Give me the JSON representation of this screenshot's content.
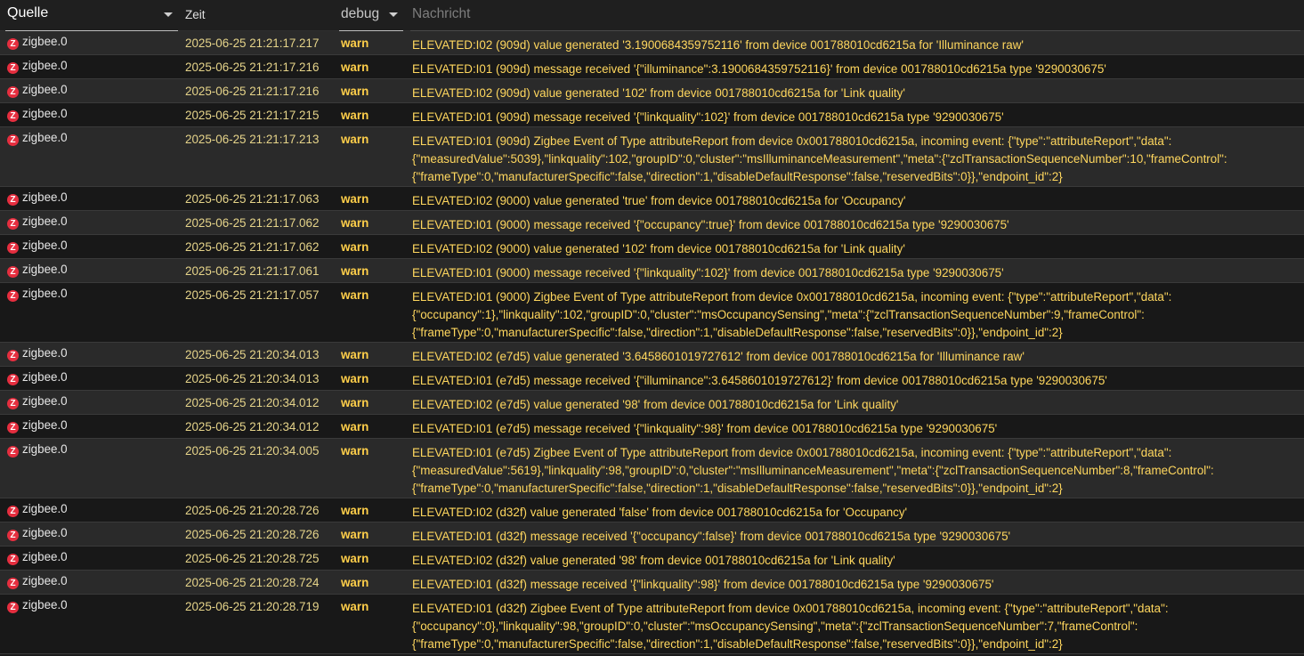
{
  "header": {
    "source_label": "Quelle",
    "time_label": "Zeit",
    "level_label": "debug",
    "message_placeholder": "Nachricht"
  },
  "rows": [
    {
      "source": "zigbee.0",
      "time": "2025-06-25 21:21:17.217",
      "level": "warn",
      "message": "ELEVATED:I02 (909d) value generated '3.1900684359752116' from device 001788010cd6215a for 'Illuminance raw'"
    },
    {
      "source": "zigbee.0",
      "time": "2025-06-25 21:21:17.216",
      "level": "warn",
      "message": "ELEVATED:I01 (909d) message received '{\"illuminance\":3.1900684359752116}' from device 001788010cd6215a type '9290030675'"
    },
    {
      "source": "zigbee.0",
      "time": "2025-06-25 21:21:17.216",
      "level": "warn",
      "message": "ELEVATED:I02 (909d) value generated '102' from device 001788010cd6215a for 'Link quality'"
    },
    {
      "source": "zigbee.0",
      "time": "2025-06-25 21:21:17.215",
      "level": "warn",
      "message": "ELEVATED:I01 (909d) message received '{\"linkquality\":102}' from device 001788010cd6215a type '9290030675'"
    },
    {
      "source": "zigbee.0",
      "time": "2025-06-25 21:21:17.213",
      "level": "warn",
      "message": "ELEVATED:I01 (909d) Zigbee Event of Type attributeReport from device 0x001788010cd6215a, incoming event: {\"type\":\"attributeReport\",\"data\": {\"measuredValue\":5039},\"linkquality\":102,\"groupID\":0,\"cluster\":\"msIlluminanceMeasurement\",\"meta\":{\"zclTransactionSequenceNumber\":10,\"frameControl\": {\"frameType\":0,\"manufacturerSpecific\":false,\"direction\":1,\"disableDefaultResponse\":false,\"reservedBits\":0}},\"endpoint_id\":2}"
    },
    {
      "source": "zigbee.0",
      "time": "2025-06-25 21:21:17.063",
      "level": "warn",
      "message": "ELEVATED:I02 (9000) value generated 'true' from device 001788010cd6215a for 'Occupancy'"
    },
    {
      "source": "zigbee.0",
      "time": "2025-06-25 21:21:17.062",
      "level": "warn",
      "message": "ELEVATED:I01 (9000) message received '{\"occupancy\":true}' from device 001788010cd6215a type '9290030675'"
    },
    {
      "source": "zigbee.0",
      "time": "2025-06-25 21:21:17.062",
      "level": "warn",
      "message": "ELEVATED:I02 (9000) value generated '102' from device 001788010cd6215a for 'Link quality'"
    },
    {
      "source": "zigbee.0",
      "time": "2025-06-25 21:21:17.061",
      "level": "warn",
      "message": "ELEVATED:I01 (9000) message received '{\"linkquality\":102}' from device 001788010cd6215a type '9290030675'"
    },
    {
      "source": "zigbee.0",
      "time": "2025-06-25 21:21:17.057",
      "level": "warn",
      "message": "ELEVATED:I01 (9000) Zigbee Event of Type attributeReport from device 0x001788010cd6215a, incoming event: {\"type\":\"attributeReport\",\"data\": {\"occupancy\":1},\"linkquality\":102,\"groupID\":0,\"cluster\":\"msOccupancySensing\",\"meta\":{\"zclTransactionSequenceNumber\":9,\"frameControl\": {\"frameType\":0,\"manufacturerSpecific\":false,\"direction\":1,\"disableDefaultResponse\":false,\"reservedBits\":0}},\"endpoint_id\":2}"
    },
    {
      "source": "zigbee.0",
      "time": "2025-06-25 21:20:34.013",
      "level": "warn",
      "message": "ELEVATED:I02 (e7d5) value generated '3.6458601019727612' from device 001788010cd6215a for 'Illuminance raw'"
    },
    {
      "source": "zigbee.0",
      "time": "2025-06-25 21:20:34.013",
      "level": "warn",
      "message": "ELEVATED:I01 (e7d5) message received '{\"illuminance\":3.6458601019727612}' from device 001788010cd6215a type '9290030675'"
    },
    {
      "source": "zigbee.0",
      "time": "2025-06-25 21:20:34.012",
      "level": "warn",
      "message": "ELEVATED:I02 (e7d5) value generated '98' from device 001788010cd6215a for 'Link quality'"
    },
    {
      "source": "zigbee.0",
      "time": "2025-06-25 21:20:34.012",
      "level": "warn",
      "message": "ELEVATED:I01 (e7d5) message received '{\"linkquality\":98}' from device 001788010cd6215a type '9290030675'"
    },
    {
      "source": "zigbee.0",
      "time": "2025-06-25 21:20:34.005",
      "level": "warn",
      "message": "ELEVATED:I01 (e7d5) Zigbee Event of Type attributeReport from device 0x001788010cd6215a, incoming event: {\"type\":\"attributeReport\",\"data\": {\"measuredValue\":5619},\"linkquality\":98,\"groupID\":0,\"cluster\":\"msIlluminanceMeasurement\",\"meta\":{\"zclTransactionSequenceNumber\":8,\"frameControl\": {\"frameType\":0,\"manufacturerSpecific\":false,\"direction\":1,\"disableDefaultResponse\":false,\"reservedBits\":0}},\"endpoint_id\":2}"
    },
    {
      "source": "zigbee.0",
      "time": "2025-06-25 21:20:28.726",
      "level": "warn",
      "message": "ELEVATED:I02 (d32f) value generated 'false' from device 001788010cd6215a for 'Occupancy'"
    },
    {
      "source": "zigbee.0",
      "time": "2025-06-25 21:20:28.726",
      "level": "warn",
      "message": "ELEVATED:I01 (d32f) message received '{\"occupancy\":false}' from device 001788010cd6215a type '9290030675'"
    },
    {
      "source": "zigbee.0",
      "time": "2025-06-25 21:20:28.725",
      "level": "warn",
      "message": "ELEVATED:I02 (d32f) value generated '98' from device 001788010cd6215a for 'Link quality'"
    },
    {
      "source": "zigbee.0",
      "time": "2025-06-25 21:20:28.724",
      "level": "warn",
      "message": "ELEVATED:I01 (d32f) message received '{\"linkquality\":98}' from device 001788010cd6215a type '9290030675'"
    },
    {
      "source": "zigbee.0",
      "time": "2025-06-25 21:20:28.719",
      "level": "warn",
      "message": "ELEVATED:I01 (d32f) Zigbee Event of Type attributeReport from device 0x001788010cd6215a, incoming event: {\"type\":\"attributeReport\",\"data\": {\"occupancy\":0},\"linkquality\":98,\"groupID\":0,\"cluster\":\"msOccupancySensing\",\"meta\":{\"zclTransactionSequenceNumber\":7,\"frameControl\": {\"frameType\":0,\"manufacturerSpecific\":false,\"direction\":1,\"disableDefaultResponse\":false,\"reservedBits\":0}},\"endpoint_id\":2}"
    }
  ]
}
